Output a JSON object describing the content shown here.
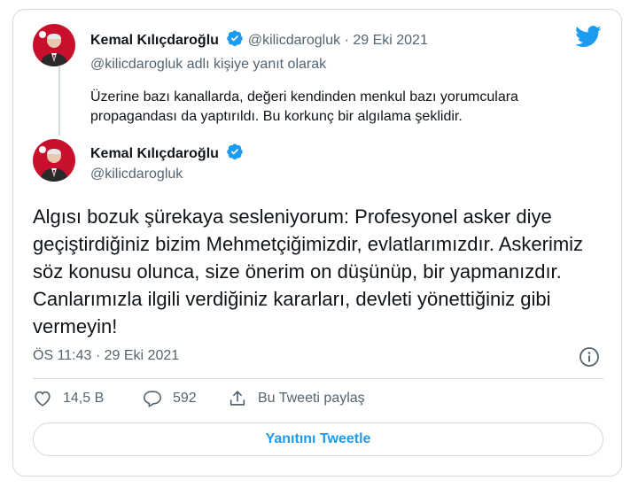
{
  "reply_tweet": {
    "author_name": "Kemal Kılıçdaroğlu",
    "handle": "@kilicdarogluk",
    "separator": "·",
    "date": "29 Eki 2021",
    "replying_to": "@kilicdarogluk adlı kişiye yanıt olarak",
    "text": "Üzerine bazı kanallarda, değeri kendinden menkul bazı yorumculara propagandası da yaptırıldı. Bu korkunç bir algılama şeklidir."
  },
  "main_tweet": {
    "author_name": "Kemal Kılıçdaroğlu",
    "handle": "@kilicdarogluk",
    "text": "Algısı bozuk şürekaya sesleniyorum: Profesyonel asker diye geçiştirdiğiniz bizim Mehmetçiğimizdir, evlatlarımızdır. Askerimiz söz konusu olunca, size önerim on düşünüp, bir yapmanızdır. Canlarımızla ilgili verdiğiniz kararları, devleti yönettiğiniz gibi vermeyin!",
    "timestamp": "ÖS 11:43 · 29 Eki 2021"
  },
  "actions": {
    "likes": "14,5 B",
    "replies": "592",
    "share_label": "Bu Tweeti paylaş"
  },
  "reply_button_label": "Yanıtını Tweetle",
  "icons": {
    "brand": "twitter-bird-icon",
    "verified": "verified-badge-icon",
    "info": "info-icon",
    "like": "heart-icon",
    "reply": "reply-bubble-icon",
    "share": "share-icon"
  },
  "colors": {
    "accent": "#1d9bf0",
    "muted": "#536471",
    "border": "#cfd9de"
  }
}
